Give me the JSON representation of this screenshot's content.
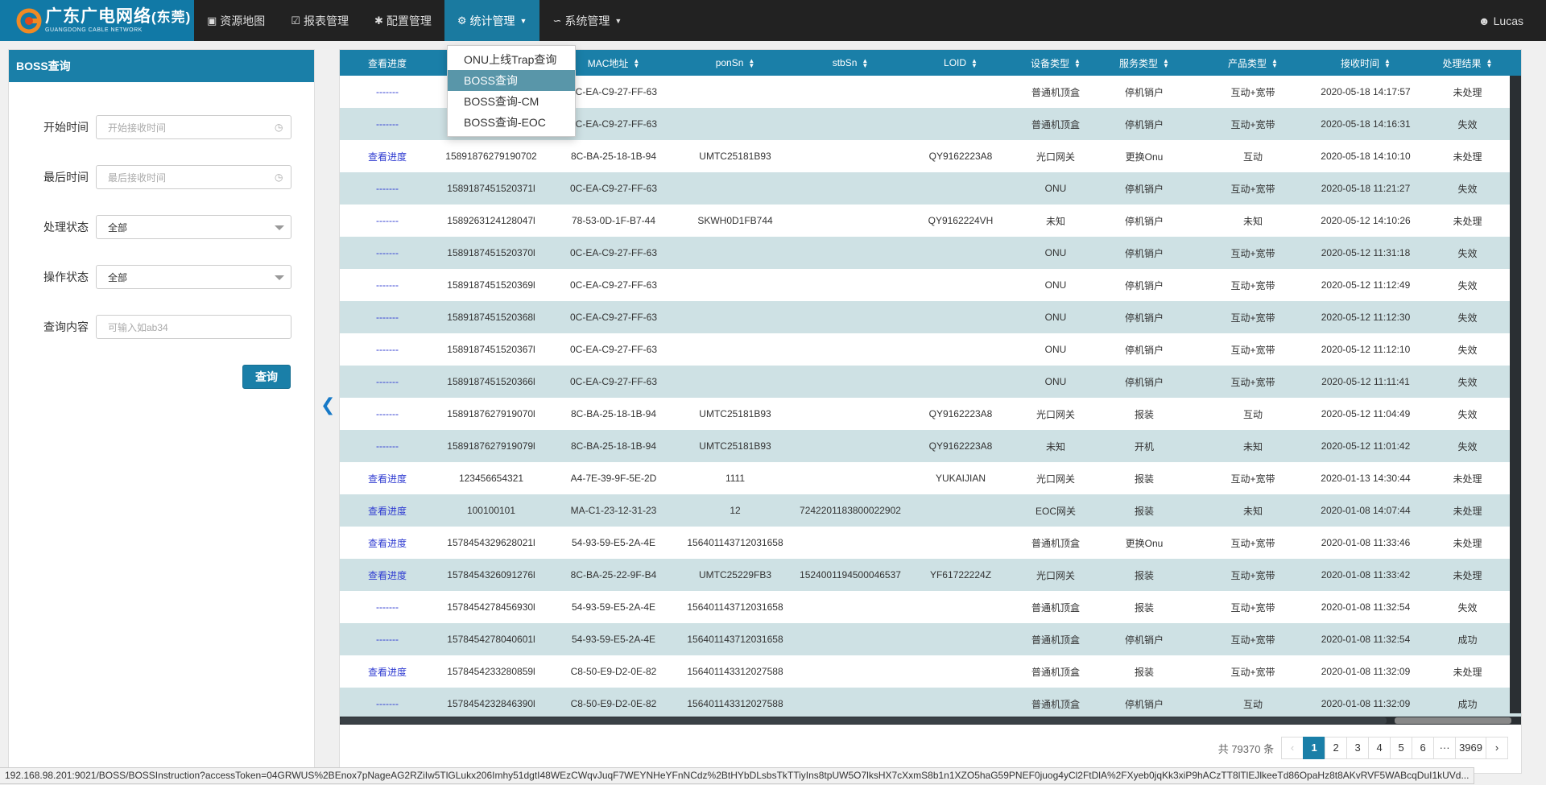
{
  "brand": {
    "title": "广东广电网络",
    "city": "(东莞)",
    "subtitle": "GUANGDONG CABLE NETWORK"
  },
  "nav": {
    "items": [
      {
        "label": "资源地图",
        "icon": "cube-icon"
      },
      {
        "label": "报表管理",
        "icon": "checkbox-icon"
      },
      {
        "label": "配置管理",
        "icon": "cogs-icon"
      },
      {
        "label": "统计管理",
        "icon": "gear-icon"
      },
      {
        "label": "系统管理",
        "icon": "line-chart-icon"
      }
    ],
    "user": "Lucas"
  },
  "dropdown": {
    "items": [
      "ONU上线Trap查询",
      "BOSS查询",
      "BOSS查询-CM",
      "BOSS查询-EOC"
    ]
  },
  "left": {
    "title": "BOSS查询",
    "start_label": "开始时间",
    "start_placeholder": "开始接收时间",
    "end_label": "最后时间",
    "end_placeholder": "最后接收时间",
    "proc_label": "处理状态",
    "proc_value": "全部",
    "op_label": "操作状态",
    "op_value": "全部",
    "content_label": "查询内容",
    "content_placeholder": "可输入如ab34",
    "query_button": "查询"
  },
  "table": {
    "headers": [
      "查看进度",
      "",
      "MAC地址",
      "ponSn",
      "stbSn",
      "LOID",
      "设备类型",
      "服务类型",
      "产品类型",
      "接收时间",
      "处理结果"
    ],
    "rows": [
      [
        "-------",
        "",
        "0C-EA-C9-27-FF-63",
        "",
        "",
        "",
        "普通机顶盒",
        "停机销户",
        "互动+宽带",
        "2020-05-18 14:17:57",
        "未处理"
      ],
      [
        "-------",
        "",
        "0C-EA-C9-27-FF-63",
        "",
        "",
        "",
        "普通机顶盒",
        "停机销户",
        "互动+宽带",
        "2020-05-18 14:16:31",
        "失效"
      ],
      [
        "查看进度",
        "15891876279190702",
        "8C-BA-25-18-1B-94",
        "UMTC25181B93",
        "",
        "QY9162223A8",
        "光口网关",
        "更换Onu",
        "互动",
        "2020-05-18 14:10:10",
        "未处理"
      ],
      [
        "-------",
        "1589187451520371l",
        "0C-EA-C9-27-FF-63",
        "",
        "",
        "",
        "ONU",
        "停机销户",
        "互动+宽带",
        "2020-05-18 11:21:27",
        "失效"
      ],
      [
        "-------",
        "1589263124128047l",
        "78-53-0D-1F-B7-44",
        "SKWH0D1FB744",
        "",
        "QY9162224VH",
        "未知",
        "停机销户",
        "未知",
        "2020-05-12 14:10:26",
        "未处理"
      ],
      [
        "-------",
        "1589187451520370l",
        "0C-EA-C9-27-FF-63",
        "",
        "",
        "",
        "ONU",
        "停机销户",
        "互动+宽带",
        "2020-05-12 11:31:18",
        "失效"
      ],
      [
        "-------",
        "1589187451520369l",
        "0C-EA-C9-27-FF-63",
        "",
        "",
        "",
        "ONU",
        "停机销户",
        "互动+宽带",
        "2020-05-12 11:12:49",
        "失效"
      ],
      [
        "-------",
        "1589187451520368l",
        "0C-EA-C9-27-FF-63",
        "",
        "",
        "",
        "ONU",
        "停机销户",
        "互动+宽带",
        "2020-05-12 11:12:30",
        "失效"
      ],
      [
        "-------",
        "1589187451520367l",
        "0C-EA-C9-27-FF-63",
        "",
        "",
        "",
        "ONU",
        "停机销户",
        "互动+宽带",
        "2020-05-12 11:12:10",
        "失效"
      ],
      [
        "-------",
        "1589187451520366l",
        "0C-EA-C9-27-FF-63",
        "",
        "",
        "",
        "ONU",
        "停机销户",
        "互动+宽带",
        "2020-05-12 11:11:41",
        "失效"
      ],
      [
        "-------",
        "1589187627919070l",
        "8C-BA-25-18-1B-94",
        "UMTC25181B93",
        "",
        "QY9162223A8",
        "光口网关",
        "报装",
        "互动",
        "2020-05-12 11:04:49",
        "失效"
      ],
      [
        "-------",
        "1589187627919079l",
        "8C-BA-25-18-1B-94",
        "UMTC25181B93",
        "",
        "QY9162223A8",
        "未知",
        "开机",
        "未知",
        "2020-05-12 11:01:42",
        "失效"
      ],
      [
        "查看进度",
        "123456654321",
        "A4-7E-39-9F-5E-2D",
        "1111",
        "",
        "YUKAIJIAN",
        "光口网关",
        "报装",
        "互动+宽带",
        "2020-01-13 14:30:44",
        "未处理"
      ],
      [
        "查看进度",
        "100100101",
        "MA-C1-23-12-31-23",
        "12",
        "7242201183800022902",
        "",
        "EOC网关",
        "报装",
        "未知",
        "2020-01-08 14:07:44",
        "未处理"
      ],
      [
        "查看进度",
        "1578454329628021l",
        "54-93-59-E5-2A-4E",
        "156401143712031658",
        "",
        "",
        "普通机顶盒",
        "更换Onu",
        "互动+宽带",
        "2020-01-08 11:33:46",
        "未处理"
      ],
      [
        "查看进度",
        "1578454326091276l",
        "8C-BA-25-22-9F-B4",
        "UMTC25229FB3",
        "1524001194500046537",
        "YF61722224Z",
        "光口网关",
        "报装",
        "互动+宽带",
        "2020-01-08 11:33:42",
        "未处理"
      ],
      [
        "-------",
        "1578454278456930l",
        "54-93-59-E5-2A-4E",
        "156401143712031658",
        "",
        "",
        "普通机顶盒",
        "报装",
        "互动+宽带",
        "2020-01-08 11:32:54",
        "失效"
      ],
      [
        "-------",
        "1578454278040601l",
        "54-93-59-E5-2A-4E",
        "156401143712031658",
        "",
        "",
        "普通机顶盒",
        "停机销户",
        "互动+宽带",
        "2020-01-08 11:32:54",
        "成功"
      ],
      [
        "查看进度",
        "1578454233280859l",
        "C8-50-E9-D2-0E-82",
        "156401143312027588",
        "",
        "",
        "普通机顶盒",
        "报装",
        "互动+宽带",
        "2020-01-08 11:32:09",
        "未处理"
      ],
      [
        "-------",
        "1578454232846390l",
        "C8-50-E9-D2-0E-82",
        "156401143312027588",
        "",
        "",
        "普通机顶盒",
        "停机销户",
        "互动",
        "2020-01-08 11:32:09",
        "成功"
      ]
    ]
  },
  "pager": {
    "total": "共 79370 条",
    "prev": "‹",
    "pages": [
      "1",
      "2",
      "3",
      "4",
      "5",
      "6"
    ],
    "ellipsis": "···",
    "last": "3969",
    "next": "›"
  },
  "statusbar": "192.168.98.201:9021/BOSS/BOSSInstruction?accessToken=04GRWUS%2BEnox7pNageAG2RZiIw5TlGLukx206Imhy51dgtI48WEzCWqvJuqF7WEYNHeYFnNCdz%2BtHYbDLsbsTkTTiyIns8tpUW5O7lksHX7cXxmS8b1n1XZO5haG59PNEF0juog4yCl2FtDlA%2FXyeb0jqKk3xiP9hACzTT8lTlEJlkeeTd86OpaHz8t8AKvRVF5WABcqDuI1kUVd..."
}
